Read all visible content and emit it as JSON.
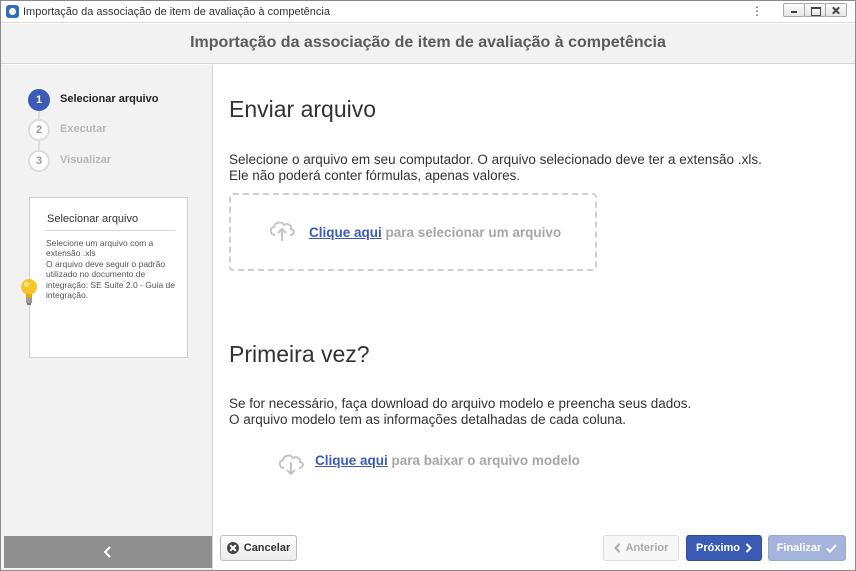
{
  "window": {
    "title": "Importação da associação de item de avaliação à competência"
  },
  "header": {
    "title": "Importação da associação de item de avaliação à competência"
  },
  "steps": [
    {
      "number": "1",
      "label": "Selecionar arquivo",
      "active": true
    },
    {
      "number": "2",
      "label": "Executar",
      "active": false
    },
    {
      "number": "3",
      "label": "Visualizar",
      "active": false
    }
  ],
  "tip": {
    "title": "Selecionar arquivo",
    "lines": [
      "Selecione um arquivo com a extensão .xls",
      "O arquivo deve seguir o padrão utilizado no documento de integração: SE Suite 2.0 - Guia de integração."
    ]
  },
  "send_section": {
    "heading": "Enviar arquivo",
    "line1": "Selecione o arquivo em seu computador. O arquivo selecionado deve ter a extensão .xls.",
    "line2": "Ele não poderá conter fórmulas, apenas valores.",
    "link": "Clique aqui",
    "link_suffix": " para selecionar um arquivo"
  },
  "first_section": {
    "heading": "Primeira vez?",
    "line1": "Se for necessário, faça download do arquivo modelo e preencha seus dados.",
    "line2": "O arquivo modelo tem as informações detalhadas de cada coluna.",
    "link": "Clique aqui",
    "link_suffix": " para baixar o arquivo modelo"
  },
  "buttons": {
    "cancel": "Cancelar",
    "previous": "Anterior",
    "next": "Próximo",
    "finish": "Finalizar"
  },
  "icons": {
    "app": "app-logo-icon",
    "upload": "cloud-upload-icon",
    "download": "cloud-download-icon",
    "tip": "lightbulb-icon",
    "collapse": "chevron-left-icon"
  },
  "colors": {
    "accent": "#3b5bb4",
    "link": "#3a5bb7",
    "finish_disabled": "#a4b4dd",
    "sidebar_bg": "#f2f2f2",
    "collapse_bar": "#8f8f8f"
  }
}
